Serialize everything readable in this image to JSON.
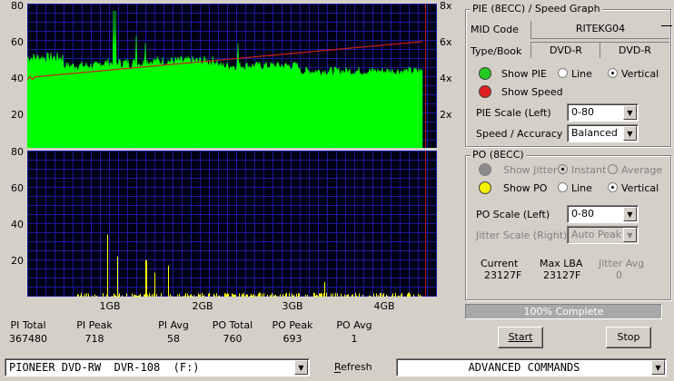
{
  "pie_chart": {
    "left_axis": [
      "80",
      "60",
      "40",
      "20"
    ],
    "right_axis": [
      "8x",
      "6x",
      "4x",
      "2x"
    ]
  },
  "po_chart": {
    "left_axis": [
      "80",
      "60",
      "40",
      "20"
    ],
    "x_axis": [
      "1GB",
      "2GB",
      "3GB",
      "4GB"
    ]
  },
  "stats": [
    {
      "label": "PI Total",
      "value": "367480"
    },
    {
      "label": "PI Peak",
      "value": "718"
    },
    {
      "label": "PI Avg",
      "value": "58"
    },
    {
      "label": "PO Total",
      "value": "760"
    },
    {
      "label": "PO Peak",
      "value": "693"
    },
    {
      "label": "PO Avg",
      "value": "1"
    }
  ],
  "pie_group": {
    "title": "PIE (8ECC) / Speed Graph",
    "mid_code_label": "MID Code",
    "mid_code_value": "RITEKG04",
    "type_book_label": "Type/Book",
    "type_value": "DVD-R",
    "book_value": "DVD-R",
    "show_pie_label": "Show PIE",
    "line_label": "Line",
    "vertical_label": "Vertical",
    "show_speed_label": "Show Speed",
    "pie_scale_label": "PIE Scale (Left)",
    "pie_scale_value": "0-80",
    "speed_accuracy_label": "Speed / Accuracy",
    "speed_accuracy_value": "Balanced",
    "pie_color": "#22cc22",
    "speed_color": "#e02020"
  },
  "po_group": {
    "title": "PO (8ECC)",
    "show_jitter_label": "Show Jitter",
    "instant_label": "Instant",
    "average_label": "Average",
    "show_po_label": "Show PO",
    "line_label": "Line",
    "vertical_label": "Vertical",
    "po_scale_label": "PO Scale (Left)",
    "po_scale_value": "0-80",
    "jitter_scale_label": "Jitter Scale (Right)",
    "jitter_scale_value": "Auto Peak",
    "current_label": "Current",
    "current_value": "23127F",
    "max_lba_label": "Max LBA",
    "max_lba_value": "23127F",
    "jitter_avg_label": "Jitter Avg",
    "jitter_avg_value": "0",
    "po_color": "#f0f000"
  },
  "progress": {
    "text": "100% Complete",
    "fraction": 1.0
  },
  "buttons": {
    "start": "Start",
    "stop": "Stop",
    "refresh": "Refresh"
  },
  "drive_select": "PIONEER DVD-RW  DVR-108  (F:)",
  "commands_select": "ADVANCED COMMANDS"
}
